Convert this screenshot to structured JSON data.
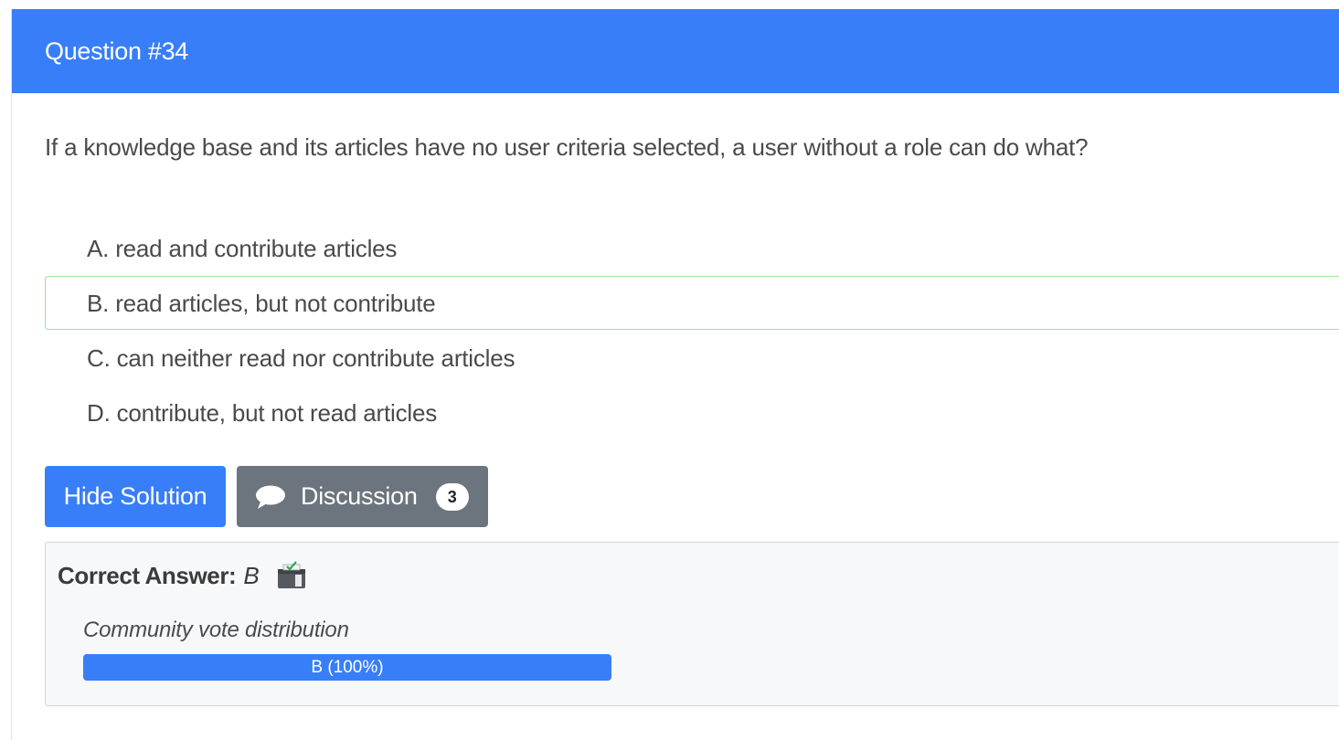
{
  "header": {
    "title": "Question #34"
  },
  "question": {
    "text": "If a knowledge base and its articles have no user criteria selected, a user without a role can do what?"
  },
  "choices": [
    {
      "text": "A. read and contribute articles"
    },
    {
      "text": "B. read articles, but not contribute"
    },
    {
      "text": "C. can neither read nor contribute articles"
    },
    {
      "text": "D. contribute, but not read articles"
    }
  ],
  "actions": {
    "hide_solution_label": "Hide Solution",
    "discussion_label": "Discussion",
    "discussion_count": "3"
  },
  "answer": {
    "label": "Correct Answer:",
    "value": "B",
    "vote_title": "Community vote distribution",
    "vote_bar_label": "B (100%)",
    "vote_percent": 100
  },
  "colors": {
    "primary": "#387ef8",
    "secondary": "#6c757d",
    "correct_border": "#a6dda6"
  },
  "icons": {
    "discussion": "speech-bubble-icon",
    "reveal": "reveal-solution-icon"
  }
}
